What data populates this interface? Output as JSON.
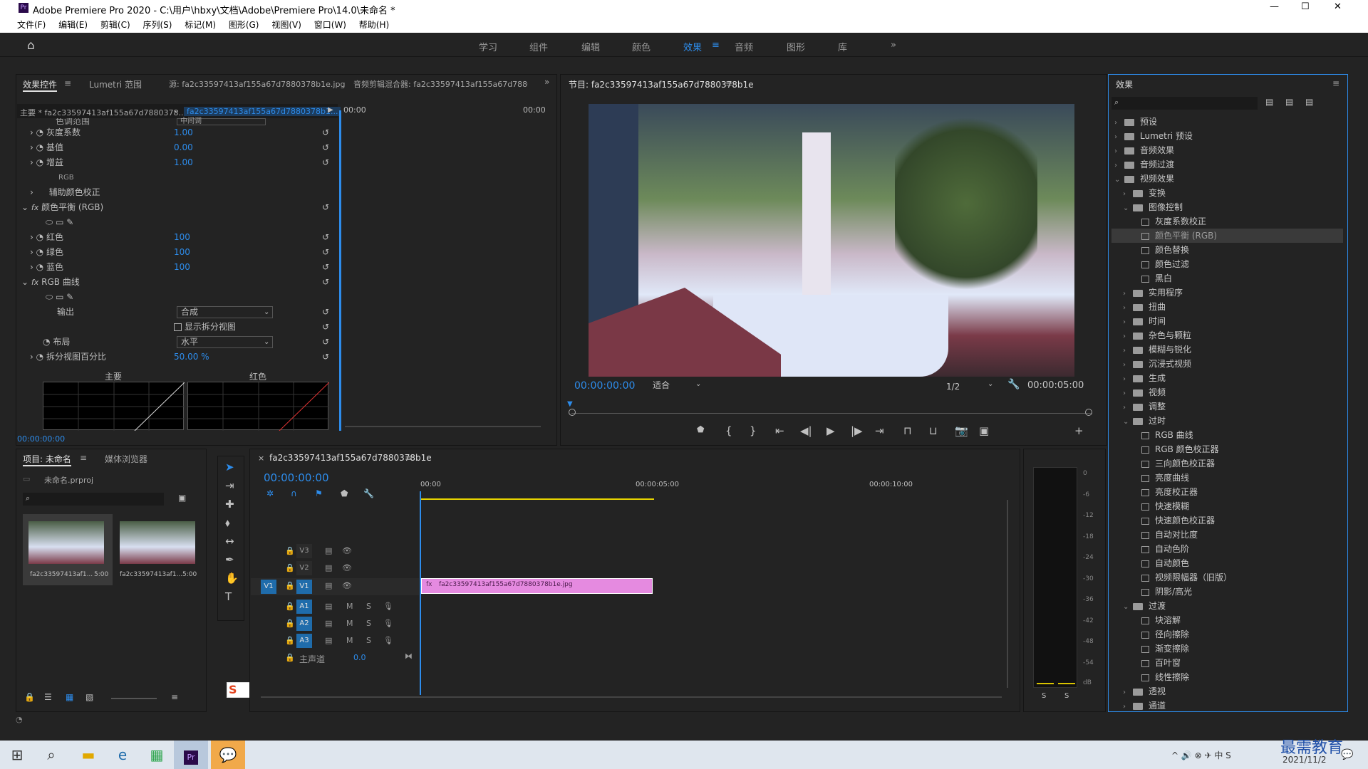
{
  "window": {
    "title": "Adobe Premiere Pro 2020 - C:\\用户\\hbxy\\文档\\Adobe\\Premiere Pro\\14.0\\未命名 *"
  },
  "menu": [
    "文件(F)",
    "编辑(E)",
    "剪辑(C)",
    "序列(S)",
    "标记(M)",
    "图形(G)",
    "视图(V)",
    "窗口(W)",
    "帮助(H)"
  ],
  "workspaces": [
    "学习",
    "组件",
    "编辑",
    "颜色",
    "效果",
    "音频",
    "图形",
    "库"
  ],
  "active_workspace": "效果",
  "effect_controls": {
    "tabs": [
      "效果控件",
      "Lumetri 范围",
      "源: fa2c33597413af155a67d7880378b1e.jpg",
      "音频剪辑混合器: fa2c33597413af155a67d7880"
    ],
    "master": "主要 * fa2c33597413af155a67d7880378...",
    "clip": "fa2c33597413af155a67d7880378b1...",
    "time_start": "00:00",
    "time_end": "00:00",
    "partial_row": "色调范围",
    "partial_value": "中间调",
    "params": [
      {
        "name": "灰度系数",
        "value": "1.00"
      },
      {
        "name": "基值",
        "value": "0.00"
      },
      {
        "name": "增益",
        "value": "1.00"
      },
      {
        "name": "RGB",
        "value": ""
      },
      {
        "name": "辅助颜色校正",
        "value": ""
      }
    ],
    "fx1": "颜色平衡 (RGB)",
    "fx1_params": [
      {
        "name": "红色",
        "value": "100"
      },
      {
        "name": "绿色",
        "value": "100"
      },
      {
        "name": "蓝色",
        "value": "100"
      }
    ],
    "fx2": "RGB 曲线",
    "output_label": "输出",
    "output_value": "合成",
    "split_label": "显示拆分视图",
    "layout_label": "布局",
    "layout_value": "水平",
    "split_pct_label": "拆分视图百分比",
    "split_pct_value": "50.00 %",
    "curve1": "主要",
    "curve2": "红色",
    "timecode": "00:00:00:00"
  },
  "program": {
    "title": "节目: fa2c33597413af155a67d7880378b1e",
    "timecode": "00:00:00:00",
    "fit": "适合",
    "res": "1/2",
    "duration": "00:00:05:00"
  },
  "effects_panel": {
    "title": "效果",
    "search_placeholder": "",
    "tree": [
      {
        "label": "预设",
        "level": 0,
        "type": "folder",
        "open": false
      },
      {
        "label": "Lumetri 预设",
        "level": 0,
        "type": "folder",
        "open": false
      },
      {
        "label": "音频效果",
        "level": 0,
        "type": "folder",
        "open": false
      },
      {
        "label": "音频过渡",
        "level": 0,
        "type": "folder",
        "open": false
      },
      {
        "label": "视频效果",
        "level": 0,
        "type": "folder",
        "open": true
      },
      {
        "label": "变换",
        "level": 1,
        "type": "folder",
        "open": false
      },
      {
        "label": "图像控制",
        "level": 1,
        "type": "folder",
        "open": true
      },
      {
        "label": "灰度系数校正",
        "level": 2,
        "type": "item"
      },
      {
        "label": "颜色平衡 (RGB)",
        "level": 2,
        "type": "item",
        "selected": true
      },
      {
        "label": "颜色替换",
        "level": 2,
        "type": "item"
      },
      {
        "label": "颜色过滤",
        "level": 2,
        "type": "item"
      },
      {
        "label": "黑白",
        "level": 2,
        "type": "item"
      },
      {
        "label": "实用程序",
        "level": 1,
        "type": "folder",
        "open": false
      },
      {
        "label": "扭曲",
        "level": 1,
        "type": "folder",
        "open": false
      },
      {
        "label": "时间",
        "level": 1,
        "type": "folder",
        "open": false
      },
      {
        "label": "杂色与颗粒",
        "level": 1,
        "type": "folder",
        "open": false
      },
      {
        "label": "模糊与锐化",
        "level": 1,
        "type": "folder",
        "open": false
      },
      {
        "label": "沉浸式视频",
        "level": 1,
        "type": "folder",
        "open": false
      },
      {
        "label": "生成",
        "level": 1,
        "type": "folder",
        "open": false
      },
      {
        "label": "视频",
        "level": 1,
        "type": "folder",
        "open": false
      },
      {
        "label": "调整",
        "level": 1,
        "type": "folder",
        "open": false
      },
      {
        "label": "过时",
        "level": 1,
        "type": "folder",
        "open": true
      },
      {
        "label": "RGB 曲线",
        "level": 2,
        "type": "item"
      },
      {
        "label": "RGB 颜色校正器",
        "level": 2,
        "type": "item"
      },
      {
        "label": "三向颜色校正器",
        "level": 2,
        "type": "item"
      },
      {
        "label": "亮度曲线",
        "level": 2,
        "type": "item"
      },
      {
        "label": "亮度校正器",
        "level": 2,
        "type": "item"
      },
      {
        "label": "快速模糊",
        "level": 2,
        "type": "item"
      },
      {
        "label": "快速颜色校正器",
        "level": 2,
        "type": "item"
      },
      {
        "label": "自动对比度",
        "level": 2,
        "type": "item"
      },
      {
        "label": "自动色阶",
        "level": 2,
        "type": "item"
      },
      {
        "label": "自动颜色",
        "level": 2,
        "type": "item"
      },
      {
        "label": "视频限幅器（旧版）",
        "level": 2,
        "type": "item"
      },
      {
        "label": "阴影/高光",
        "level": 2,
        "type": "item"
      },
      {
        "label": "过渡",
        "level": 1,
        "type": "folder",
        "open": true
      },
      {
        "label": "块溶解",
        "level": 2,
        "type": "item"
      },
      {
        "label": "径向擦除",
        "level": 2,
        "type": "item"
      },
      {
        "label": "渐变擦除",
        "level": 2,
        "type": "item"
      },
      {
        "label": "百叶窗",
        "level": 2,
        "type": "item"
      },
      {
        "label": "线性擦除",
        "level": 2,
        "type": "item"
      },
      {
        "label": "透视",
        "level": 1,
        "type": "folder",
        "open": false
      },
      {
        "label": "通道",
        "level": 1,
        "type": "folder",
        "open": false
      }
    ]
  },
  "project": {
    "tabs": [
      "项目: 未命名",
      "媒体浏览器"
    ],
    "file": "未命名.prproj",
    "items": [
      {
        "name": "fa2c33597413af1...",
        "dur": "5:00"
      },
      {
        "name": "fa2c33597413af1...",
        "dur": "5:00"
      }
    ]
  },
  "timeline": {
    "tab": "fa2c33597413af155a67d7880378b1e",
    "timecode": "00:00:00:00",
    "ruler": [
      "00:00",
      "00:00:05:00",
      "00:00:10:00"
    ],
    "video_tracks": [
      "V3",
      "V2",
      "V1"
    ],
    "audio_tracks": [
      "A1",
      "A2",
      "A3"
    ],
    "source_v": "V1",
    "master": "主声道",
    "master_value": "0.0",
    "mute": "M",
    "solo": "S",
    "clip": "fa2c33597413af155a67d7880378b1e.jpg"
  },
  "meter": {
    "scale": [
      "0",
      "-6",
      "-12",
      "-18",
      "-24",
      "-30",
      "-36",
      "-42",
      "-48",
      "-54",
      "dB"
    ],
    "solo": "S"
  },
  "ime": {
    "label": "中"
  },
  "taskbar": {
    "date": "2021/11/2"
  },
  "watermark": "最需教育"
}
